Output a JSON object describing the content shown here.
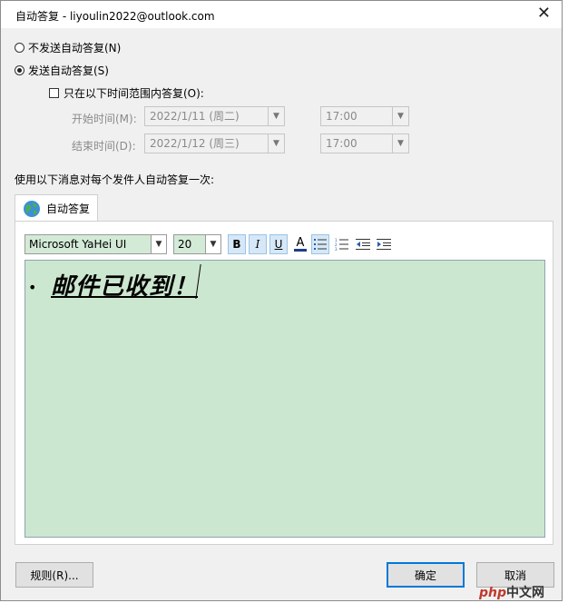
{
  "window": {
    "title": "自动答复 - liyoulin2022@outlook.com",
    "close": "✕"
  },
  "options": {
    "no_reply": "不发送自动答复(N)",
    "send_reply": "发送自动答复(S)",
    "only_range": "只在以下时间范围内答复(O):"
  },
  "time": {
    "start_label": "开始时间(M):",
    "start_date": "2022/1/11 (周二)",
    "start_time": "17:00",
    "end_label": "结束时间(D):",
    "end_date": "2022/1/12 (周三)",
    "end_time": "17:00"
  },
  "section_label": "使用以下消息对每个发件人自动答复一次:",
  "tab": {
    "label": "自动答复"
  },
  "toolbar": {
    "font": "Microsoft YaHei UI",
    "size": "20",
    "bold": "B",
    "italic": "I",
    "underline": "U",
    "font_color": "A"
  },
  "message": {
    "text": "邮件已收到！"
  },
  "buttons": {
    "rules": "规则(R)...",
    "ok": "确定",
    "cancel": "取消"
  },
  "watermark": {
    "brand": "php",
    "site": "中文网"
  },
  "colors": {
    "editor_bg": "#cce7cf",
    "accent": "#0078d7"
  }
}
